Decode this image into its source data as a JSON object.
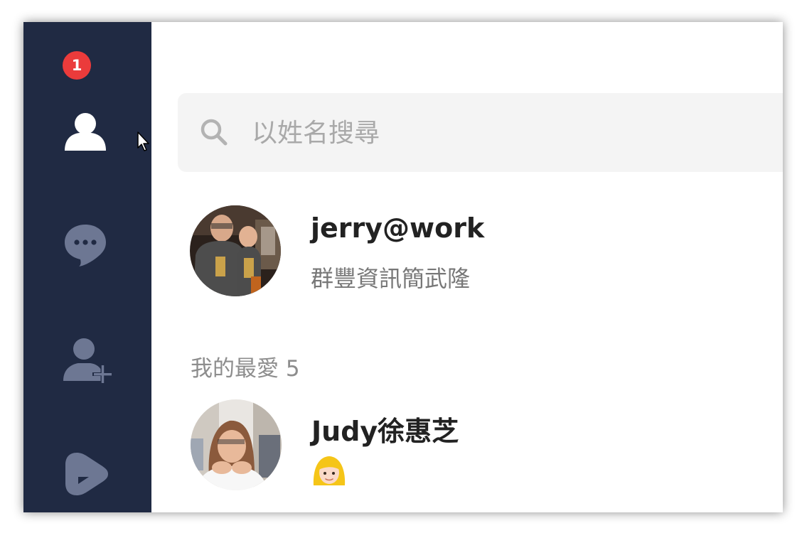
{
  "sidebar": {
    "items": [
      {
        "name": "friends",
        "icon": "person-icon",
        "badge": "1",
        "active": true
      },
      {
        "name": "chats",
        "icon": "chat-bubble-icon"
      },
      {
        "name": "add-friend",
        "icon": "add-person-icon"
      },
      {
        "name": "voom",
        "icon": "play-icon"
      }
    ],
    "active_color": "#ffffff",
    "inactive_color": "#6d7793",
    "background": "#202a43",
    "badge_color": "#eb3b3b"
  },
  "search": {
    "placeholder": "以姓名搜尋",
    "icon": "search-icon"
  },
  "profile": {
    "name": "jerry@work",
    "status": "群豐資訊簡武隆"
  },
  "favorites": {
    "label": "我的最愛 5",
    "items": [
      {
        "name": "Judy徐惠芝",
        "status": "👱‍♀️"
      }
    ]
  }
}
